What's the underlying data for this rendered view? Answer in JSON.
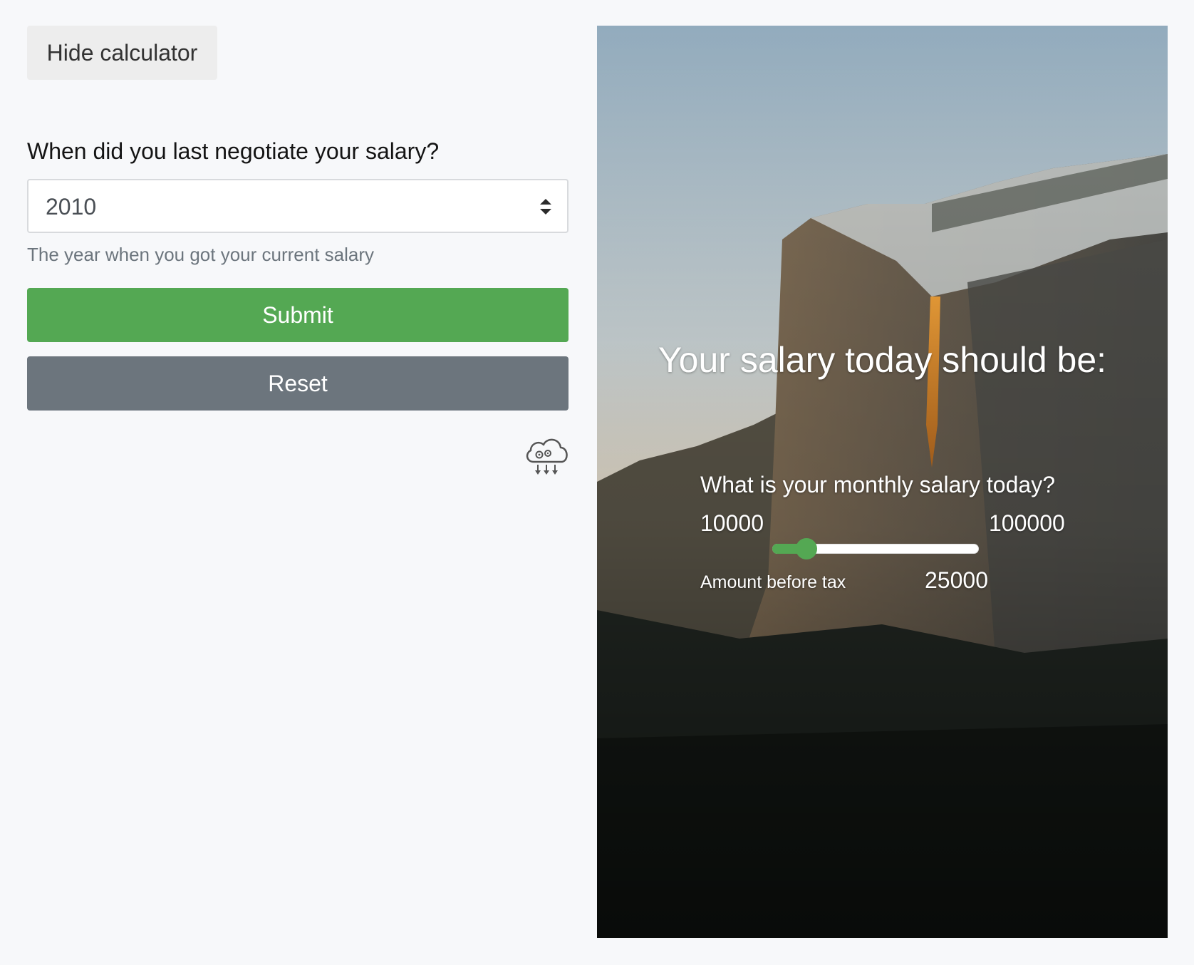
{
  "toolbar": {
    "hide_label": "Hide calculator"
  },
  "form": {
    "question": "When did you last negotiate your salary?",
    "year_selected": "2010",
    "help_text": "The year when you got your current salary",
    "submit_label": "Submit",
    "reset_label": "Reset"
  },
  "result": {
    "title": "Your salary today should be:",
    "monthly_question": "What is your monthly salary today?",
    "slider_min": "10000",
    "slider_max": "100000",
    "slider_value": 25000,
    "current_value": "25000",
    "helper": "Amount before tax"
  },
  "theme": {
    "accent": "#54a853",
    "secondary": "#6c757d",
    "background": "#f7f8fa"
  },
  "icons": {
    "select": "sort-arrows-icon",
    "footer": "cloud-gears-icon"
  }
}
